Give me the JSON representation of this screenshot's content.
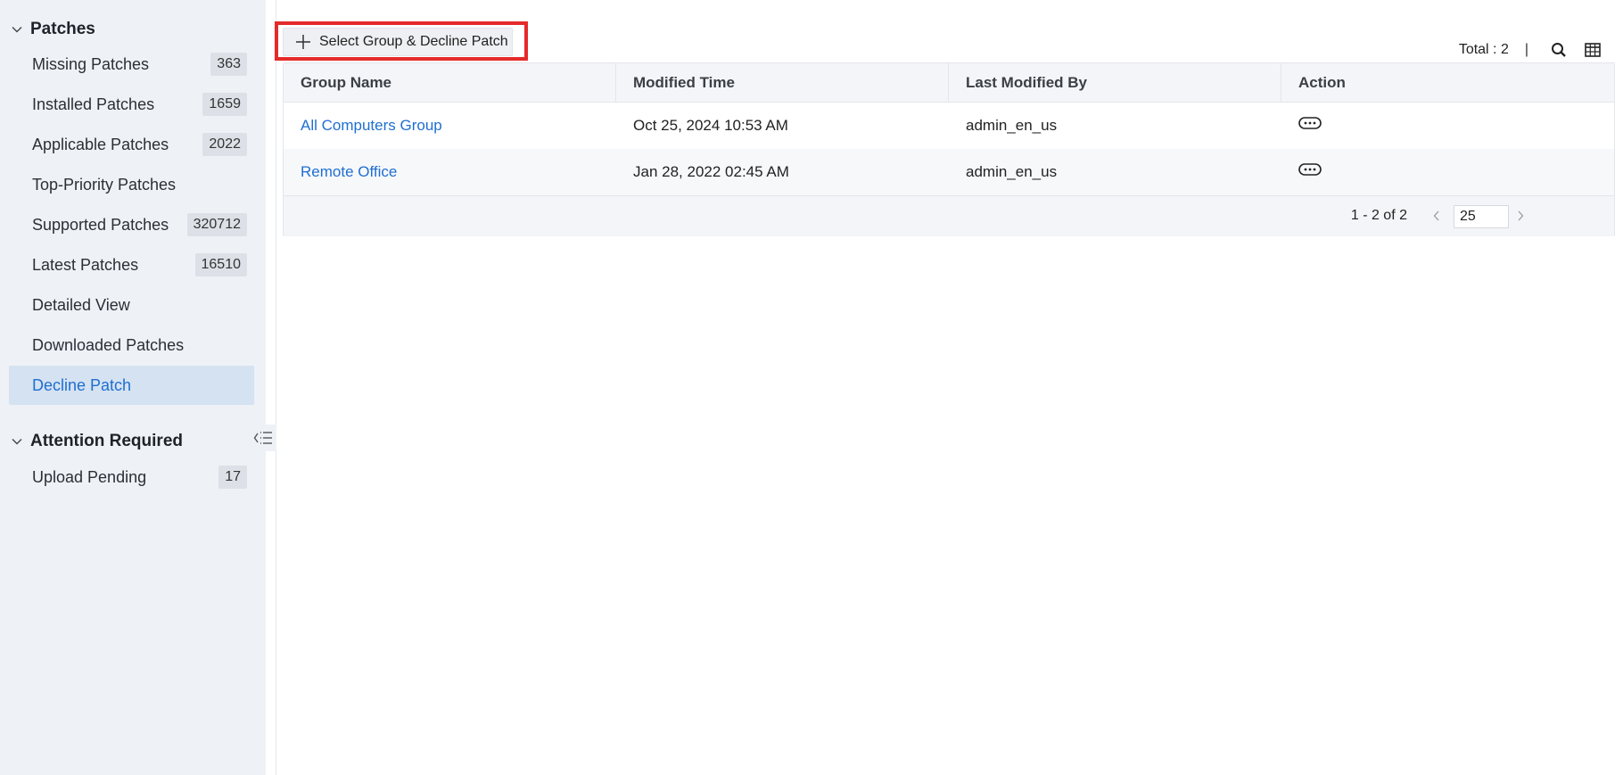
{
  "sidebar": {
    "sections": [
      {
        "title": "Patches",
        "items": [
          {
            "label": "Missing Patches",
            "count": "363"
          },
          {
            "label": "Installed Patches",
            "count": "1659"
          },
          {
            "label": "Applicable Patches",
            "count": "2022"
          },
          {
            "label": "Top-Priority Patches",
            "count": ""
          },
          {
            "label": "Supported Patches",
            "count": "320712"
          },
          {
            "label": "Latest Patches",
            "count": "16510"
          },
          {
            "label": "Detailed View",
            "count": ""
          },
          {
            "label": "Downloaded Patches",
            "count": ""
          },
          {
            "label": "Decline Patch",
            "count": "",
            "active": true
          }
        ]
      },
      {
        "title": "Attention Required",
        "items": [
          {
            "label": "Upload Pending",
            "count": "17"
          }
        ]
      }
    ],
    "collapse_icon": "collapse-sidebar-icon"
  },
  "toolbar": {
    "add_label": "Select Group & Decline Patch",
    "total_label": "Total : 2",
    "separator": "|",
    "icons": [
      "search-icon",
      "column-chooser-icon"
    ]
  },
  "table": {
    "columns": [
      "Group Name",
      "Modified Time",
      "Last Modified By",
      "Action"
    ],
    "rows": [
      {
        "group": "All Computers Group",
        "modified": "Oct 25, 2024 10:53 AM",
        "by": "admin_en_us"
      },
      {
        "group": "Remote Office",
        "modified": "Jan 28, 2022 02:45 AM",
        "by": "admin_en_us"
      }
    ]
  },
  "pagination": {
    "range": "1 - 2 of 2",
    "page_size": "25"
  },
  "colors": {
    "accent": "#1f6fd1",
    "highlight_frame": "#e52a2a",
    "sidebar_bg": "#eef1f6",
    "active_bg": "#d5e2f1"
  }
}
